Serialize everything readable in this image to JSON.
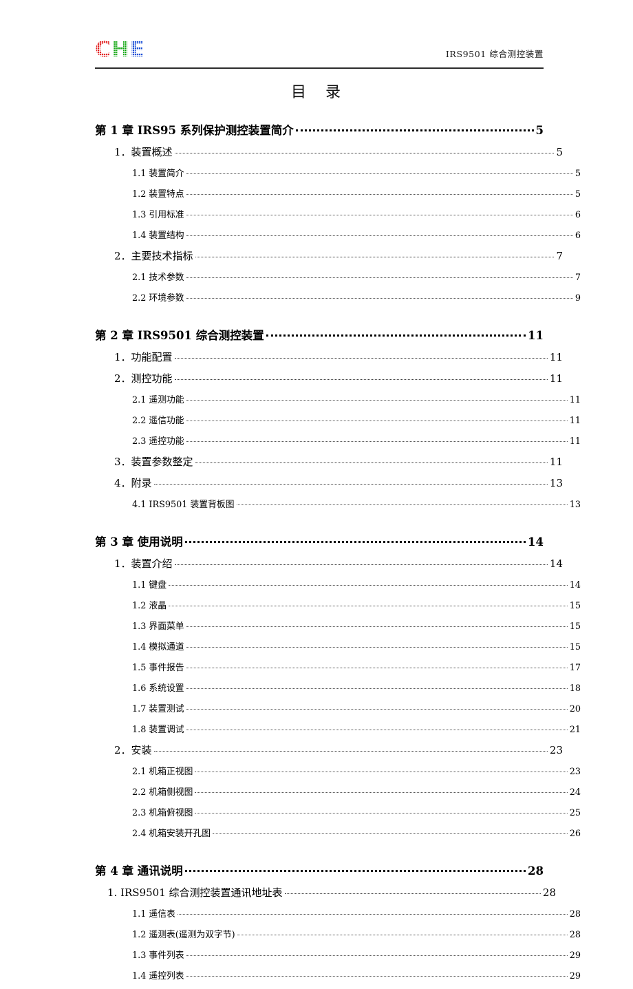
{
  "header": {
    "logo_parts": [
      "C",
      "H",
      "E"
    ],
    "logo_colors": [
      "#e21d1d",
      "#14a814",
      "#1a4fd6"
    ],
    "title": "IRS9501 综合测控装置"
  },
  "doc_title": {
    "left": "目",
    "right": "录"
  },
  "toc": {
    "entries": [
      {
        "level": "chapter",
        "label": "第 1 章  IRS95 系列保护测控装置简介",
        "page": "5"
      },
      {
        "level": "1",
        "label": "1．装置概述",
        "page": "5"
      },
      {
        "level": "2",
        "label": "1.1 装置简介",
        "page": "5"
      },
      {
        "level": "2",
        "label": "1.2 装置特点",
        "page": "5"
      },
      {
        "level": "2",
        "label": "1.3 引用标准",
        "page": "6"
      },
      {
        "level": "2",
        "label": "1.4 装置结构",
        "page": "6"
      },
      {
        "level": "1",
        "label": "2．主要技术指标",
        "page": "7"
      },
      {
        "level": "2",
        "label": "2.1 技术参数",
        "page": "7"
      },
      {
        "level": "2",
        "label": "2.2 环境参数",
        "page": "9"
      },
      {
        "level": "chapter",
        "label": "第 2 章  IRS9501 综合测控装置",
        "page": "11"
      },
      {
        "level": "1",
        "label": "1．功能配置",
        "page": "11"
      },
      {
        "level": "1",
        "label": "2．测控功能",
        "page": "11"
      },
      {
        "level": "2",
        "label": "2.1 遥测功能",
        "page": "11"
      },
      {
        "level": "2",
        "label": "2.2 遥信功能",
        "page": "11"
      },
      {
        "level": "2",
        "label": "2.3 遥控功能",
        "page": "11"
      },
      {
        "level": "1",
        "label": "3．装置参数整定",
        "page": "11"
      },
      {
        "level": "1",
        "label": "4．附录",
        "page": "13"
      },
      {
        "level": "2",
        "label": "4.1 IRS9501 装置背板图",
        "page": "13"
      },
      {
        "level": "chapter",
        "label": "第 3 章  使用说明",
        "page": "14"
      },
      {
        "level": "1",
        "label": "1．装置介绍",
        "page": "14"
      },
      {
        "level": "2",
        "label": "1.1  键盘",
        "page": "14"
      },
      {
        "level": "2",
        "label": "1.2  液晶",
        "page": "15"
      },
      {
        "level": "2",
        "label": "1.3  界面菜单",
        "page": "15"
      },
      {
        "level": "2",
        "label": "1.4  模拟通道",
        "page": "15"
      },
      {
        "level": "2",
        "label": "1.5  事件报告",
        "page": "17"
      },
      {
        "level": "2",
        "label": "1.6  系统设置",
        "page": "18"
      },
      {
        "level": "2",
        "label": "1.7  装置测试",
        "page": "20"
      },
      {
        "level": "2",
        "label": "1.8  装置调试",
        "page": "21"
      },
      {
        "level": "1",
        "label": "2．安装",
        "page": "23"
      },
      {
        "level": "2",
        "label": "2.1 机箱正视图",
        "page": "23"
      },
      {
        "level": "2",
        "label": "2.2 机箱侧视图",
        "page": "24"
      },
      {
        "level": "2",
        "label": "2.3 机箱俯视图",
        "page": "25"
      },
      {
        "level": "2",
        "label": "2.4 机箱安装开孔图",
        "page": "26"
      },
      {
        "level": "chapter",
        "label": "第 4 章  通讯说明",
        "page": "28"
      },
      {
        "level": "1b",
        "label": "1. IRS9501 综合测控装置通讯地址表",
        "page": "28"
      },
      {
        "level": "2",
        "label": "1.1  遥信表",
        "page": "28"
      },
      {
        "level": "2",
        "label": "1.2  遥测表(遥测为双字节)",
        "page": "28"
      },
      {
        "level": "2",
        "label": "1.3  事件列表",
        "page": "29"
      },
      {
        "level": "2",
        "label": "1.4  遥控列表",
        "page": "29"
      }
    ]
  }
}
